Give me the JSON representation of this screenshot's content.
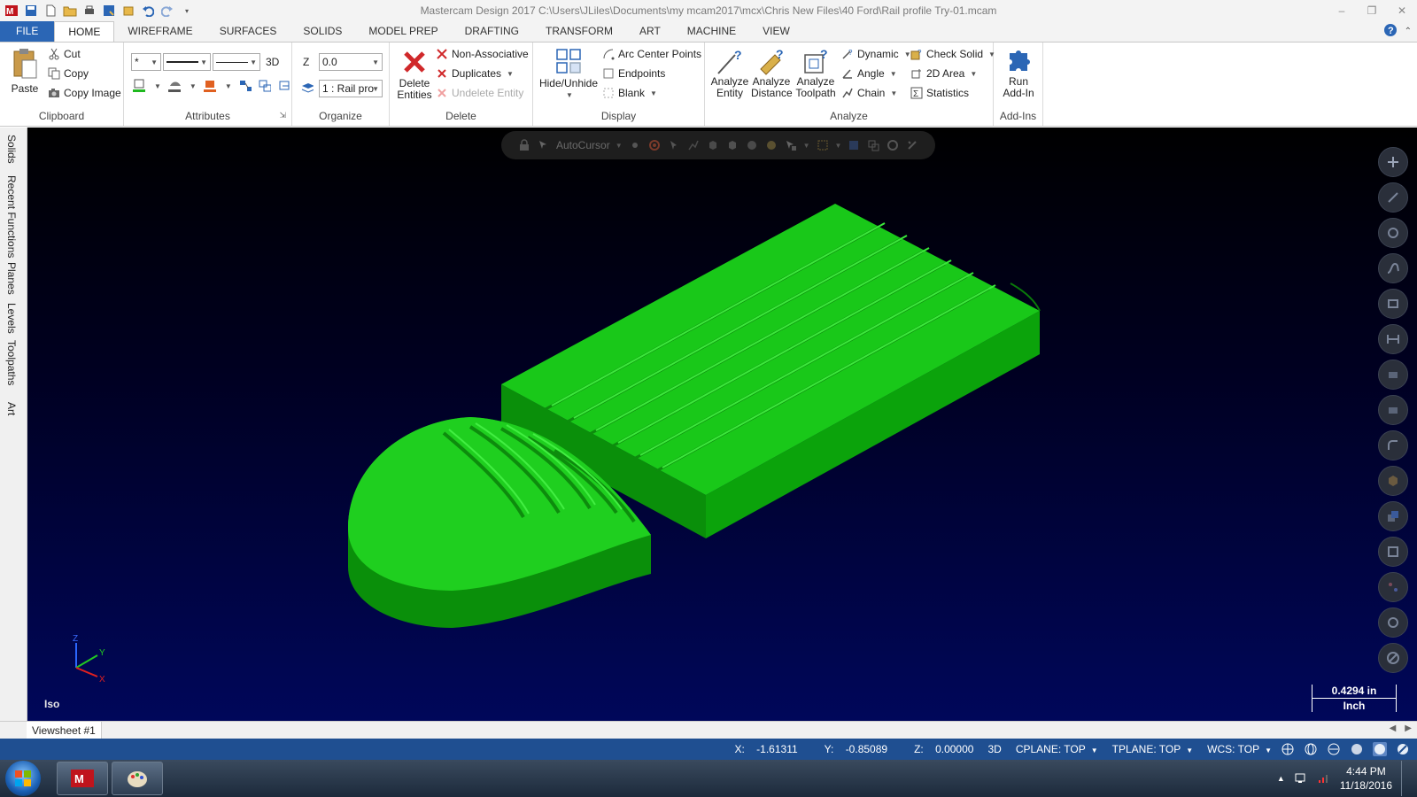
{
  "window": {
    "title": "Mastercam Design 2017  C:\\Users\\JLiles\\Documents\\my mcam2017\\mcx\\Chris New Files\\40 Ford\\Rail profile Try-01.mcam",
    "controls": [
      "–",
      "❐",
      "✕"
    ]
  },
  "tabs": {
    "file": "FILE",
    "items": [
      "HOME",
      "WIREFRAME",
      "SURFACES",
      "SOLIDS",
      "MODEL PREP",
      "DRAFTING",
      "TRANSFORM",
      "ART",
      "MACHINE",
      "VIEW"
    ]
  },
  "ribbon": {
    "clipboard": {
      "label": "Clipboard",
      "paste": "Paste",
      "cut": "Cut",
      "copy": "Copy",
      "copy_image": "Copy Image"
    },
    "attributes": {
      "label": "Attributes",
      "point_style": "*",
      "mode_3d": "3D"
    },
    "organize": {
      "label": "Organize",
      "z_label": "Z",
      "z_value": "0.0",
      "level": "1 : Rail pro"
    },
    "delete": {
      "label": "Delete",
      "delete_entities": "Delete Entities",
      "non_associative": "Non-Associative",
      "duplicates": "Duplicates",
      "undelete_entity": "Undelete Entity"
    },
    "display": {
      "label": "Display",
      "hide_unhide": "Hide/Unhide",
      "arc_center_points": "Arc Center Points",
      "endpoints": "Endpoints",
      "blank": "Blank"
    },
    "analyze": {
      "label": "Analyze",
      "analyze_entity": "Analyze Entity",
      "analyze_distance": "Analyze Distance",
      "analyze_toolpath": "Analyze Toolpath",
      "dynamic": "Dynamic",
      "angle": "Angle",
      "chain": "Chain",
      "check_solid": "Check Solid",
      "area_2d": "2D Area",
      "statistics": "Statistics"
    },
    "addins": {
      "label": "Add-Ins",
      "run_addin": "Run Add-In"
    }
  },
  "left_panel": {
    "tabs": [
      "Solids",
      "Recent Functions",
      "Planes",
      "Levels",
      "Toolpaths",
      "Art"
    ]
  },
  "viewport": {
    "autocursor": "AutoCursor",
    "view_name": "Iso",
    "axis_labels": {
      "z": "Z",
      "y": "Y",
      "x": "X"
    },
    "scale_value": "0.4294 in",
    "scale_unit": "Inch",
    "model_color": "#1fcf1f"
  },
  "viewsheet": {
    "tab": "Viewsheet #1"
  },
  "status": {
    "x_label": "X:",
    "x_value": "-1.61311",
    "y_label": "Y:",
    "y_value": "-0.85089",
    "z_label": "Z:",
    "z_value": "0.00000",
    "mode": "3D",
    "cplane": "CPLANE: TOP",
    "tplane": "TPLANE: TOP",
    "wcs": "WCS: TOP"
  },
  "taskbar": {
    "time": "4:44 PM",
    "date": "11/18/2016"
  }
}
